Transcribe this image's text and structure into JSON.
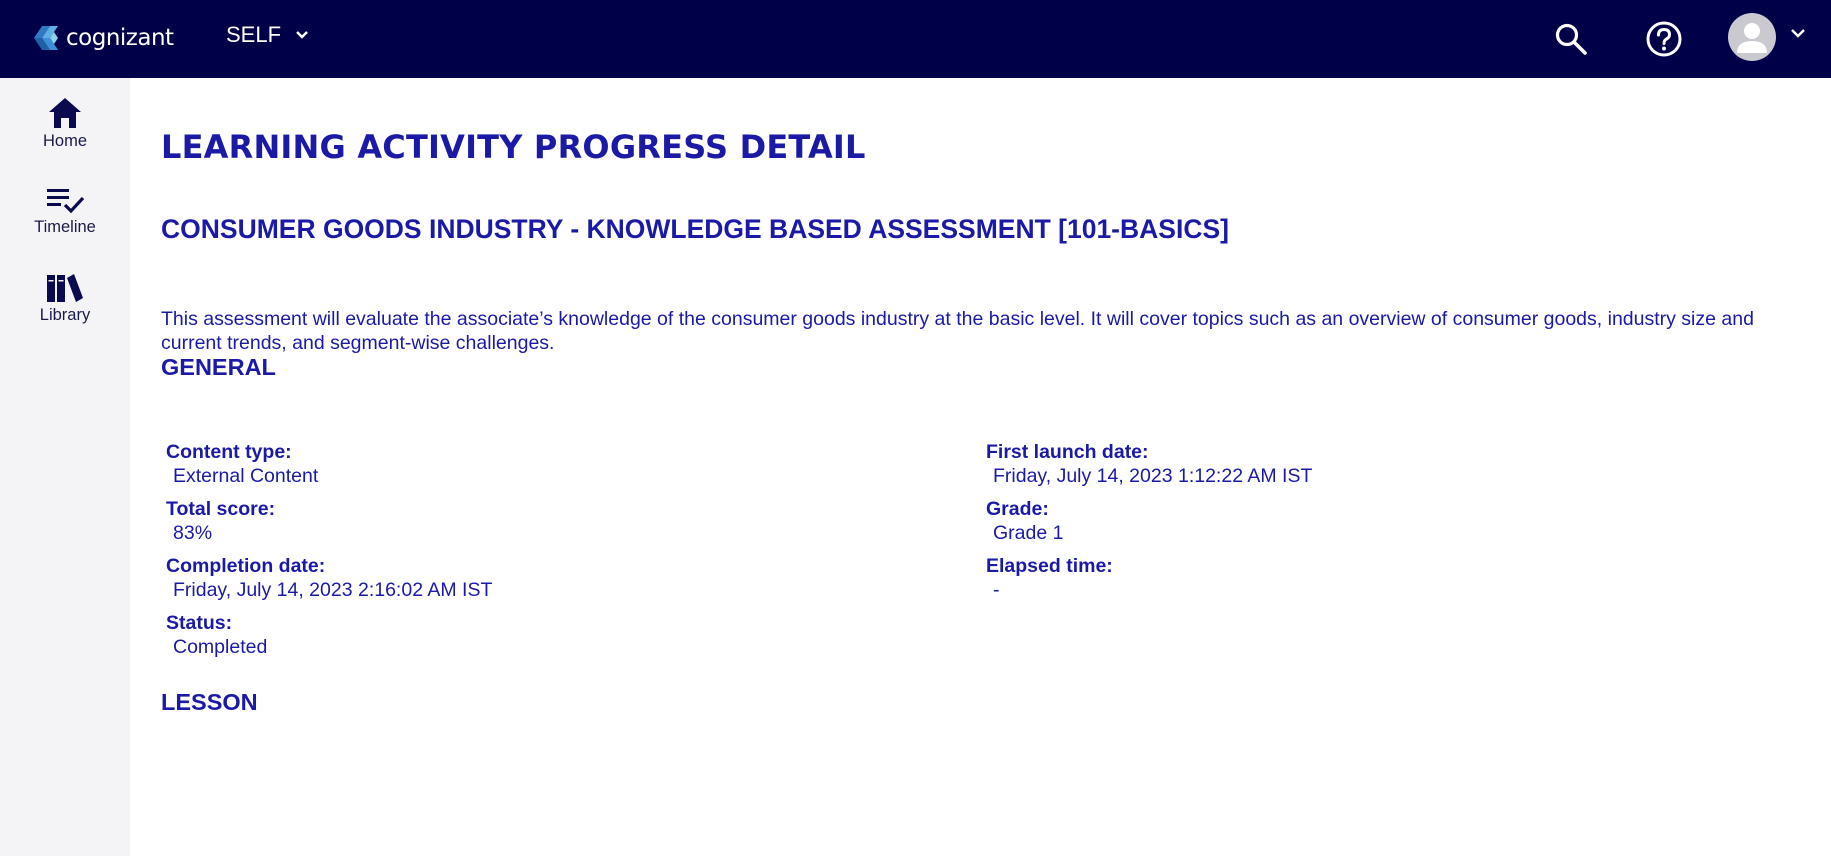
{
  "header": {
    "brand": "cognizant",
    "context_selector": "SELF",
    "colors": {
      "bar": "#000048",
      "accent": "#1a1aa6"
    },
    "icons": [
      "search-icon",
      "help-icon",
      "avatar-icon",
      "chevron-down-icon"
    ]
  },
  "sidebar": {
    "items": [
      {
        "label": "Home",
        "icon": "home-icon"
      },
      {
        "label": "Timeline",
        "icon": "timeline-icon"
      },
      {
        "label": "Library",
        "icon": "library-icon"
      }
    ]
  },
  "main": {
    "page_title": "LEARNING ACTIVITY PROGRESS DETAIL",
    "course_title": "CONSUMER GOODS INDUSTRY - KNOWLEDGE BASED ASSESSMENT [101-BASICS]",
    "description": "This assessment will evaluate the associate’s knowledge of the consumer goods industry at the basic level. It will cover topics such as an overview of consumer goods, industry size and current trends, and segment-wise challenges.",
    "general_heading": "GENERAL",
    "left_fields": [
      {
        "label": "Content type:",
        "value": "External Content"
      },
      {
        "label": "Total score:",
        "value": "83%"
      },
      {
        "label": "Completion date:",
        "value": "Friday, July 14, 2023 2:16:02 AM IST"
      },
      {
        "label": "Status:",
        "value": "Completed"
      }
    ],
    "right_fields": [
      {
        "label": "First launch date:",
        "value": "Friday, July 14, 2023 1:12:22 AM IST"
      },
      {
        "label": "Grade:",
        "value": "Grade 1"
      },
      {
        "label": "Elapsed time:",
        "value": "-"
      }
    ],
    "lesson_heading": "LESSON"
  }
}
